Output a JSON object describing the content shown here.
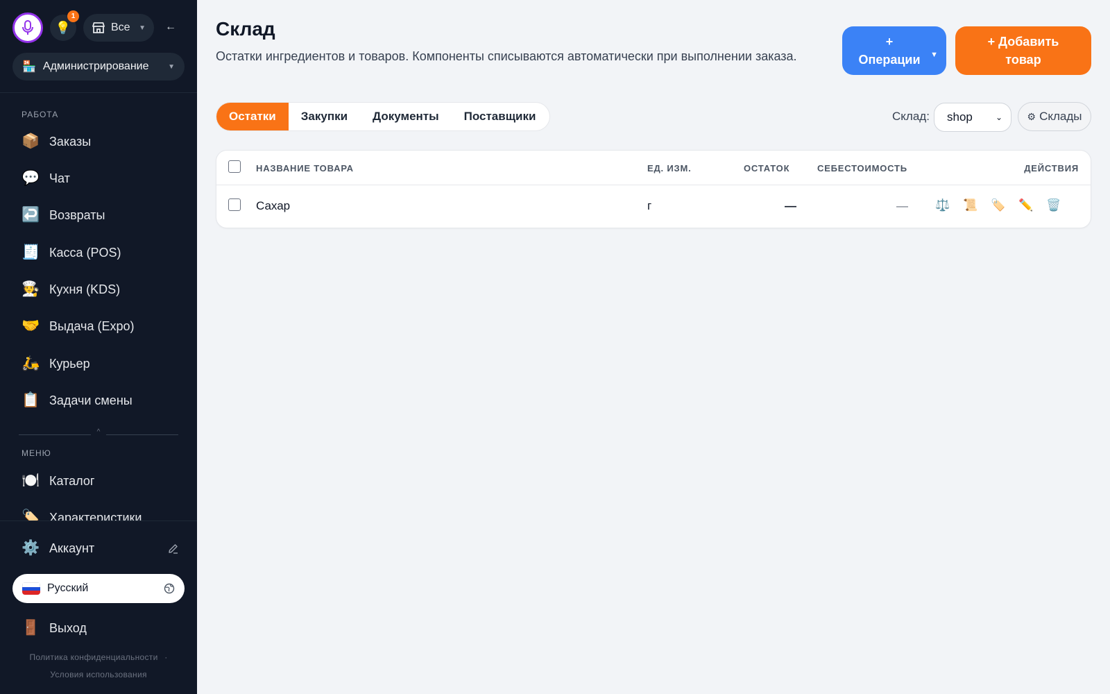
{
  "sidebar": {
    "store_filter": "Все",
    "notification_count": "1",
    "collapse_glyph": "←",
    "mode_select": {
      "icon": "🏪",
      "label": "Администрирование"
    },
    "work_section": "РАБОТА",
    "work_items": [
      {
        "icon": "📦",
        "label": "Заказы"
      },
      {
        "icon": "💬",
        "label": "Чат"
      },
      {
        "icon": "↩️",
        "label": "Возвраты"
      },
      {
        "icon": "🧾",
        "label": "Касса (POS)"
      },
      {
        "icon": "🧑‍🍳",
        "label": "Кухня (KDS)"
      },
      {
        "icon": "🤝",
        "label": "Выдача (Expo)"
      },
      {
        "icon": "🛵",
        "label": "Курьер"
      },
      {
        "icon": "📋",
        "label": "Задачи смены"
      }
    ],
    "menu_section": "МЕНЮ",
    "menu_items": [
      {
        "icon": "🍽️",
        "label": "Каталог"
      },
      {
        "icon": "🏷️",
        "label": "Характеристики"
      }
    ],
    "account": {
      "icon": "⚙️",
      "label": "Аккаунт"
    },
    "language": "Русский",
    "logout": {
      "icon": "🚪",
      "label": "Выход"
    },
    "privacy_link": "Политика конфиденциальности",
    "legal_separator": "·",
    "terms_link": "Условия использования"
  },
  "main": {
    "title": "Склад",
    "description": "Остатки ингредиентов и товаров. Компоненты списываются автоматически при выполнении заказа.",
    "operations_button": {
      "line1": "+",
      "line2": "Операции"
    },
    "add_button": {
      "line1": "+ Добавить",
      "line2": "товар"
    },
    "tabs": [
      "Остатки",
      "Закупки",
      "Документы",
      "Поставщики"
    ],
    "active_tab": "Остатки",
    "warehouse_label": "Склад:",
    "warehouse_value": "shop",
    "warehouses_button": "Склады",
    "table": {
      "columns": [
        "НАЗВАНИЕ ТОВАРА",
        "ЕД. ИЗМ.",
        "ОСТАТОК",
        "СЕБЕСТОИМОСТЬ",
        "ДЕЙСТВИЯ"
      ],
      "rows": [
        {
          "name": "Сахар",
          "unit": "г",
          "stock": "—",
          "cost": "—"
        }
      ],
      "action_icons": [
        "⚖️",
        "📜",
        "🏷️",
        "✏️",
        "🗑️"
      ]
    }
  },
  "colors": {
    "sidebar_bg": "#111827",
    "accent_orange": "#f97316",
    "accent_blue": "#3b82f6",
    "mic_ring": "#9333ea"
  }
}
